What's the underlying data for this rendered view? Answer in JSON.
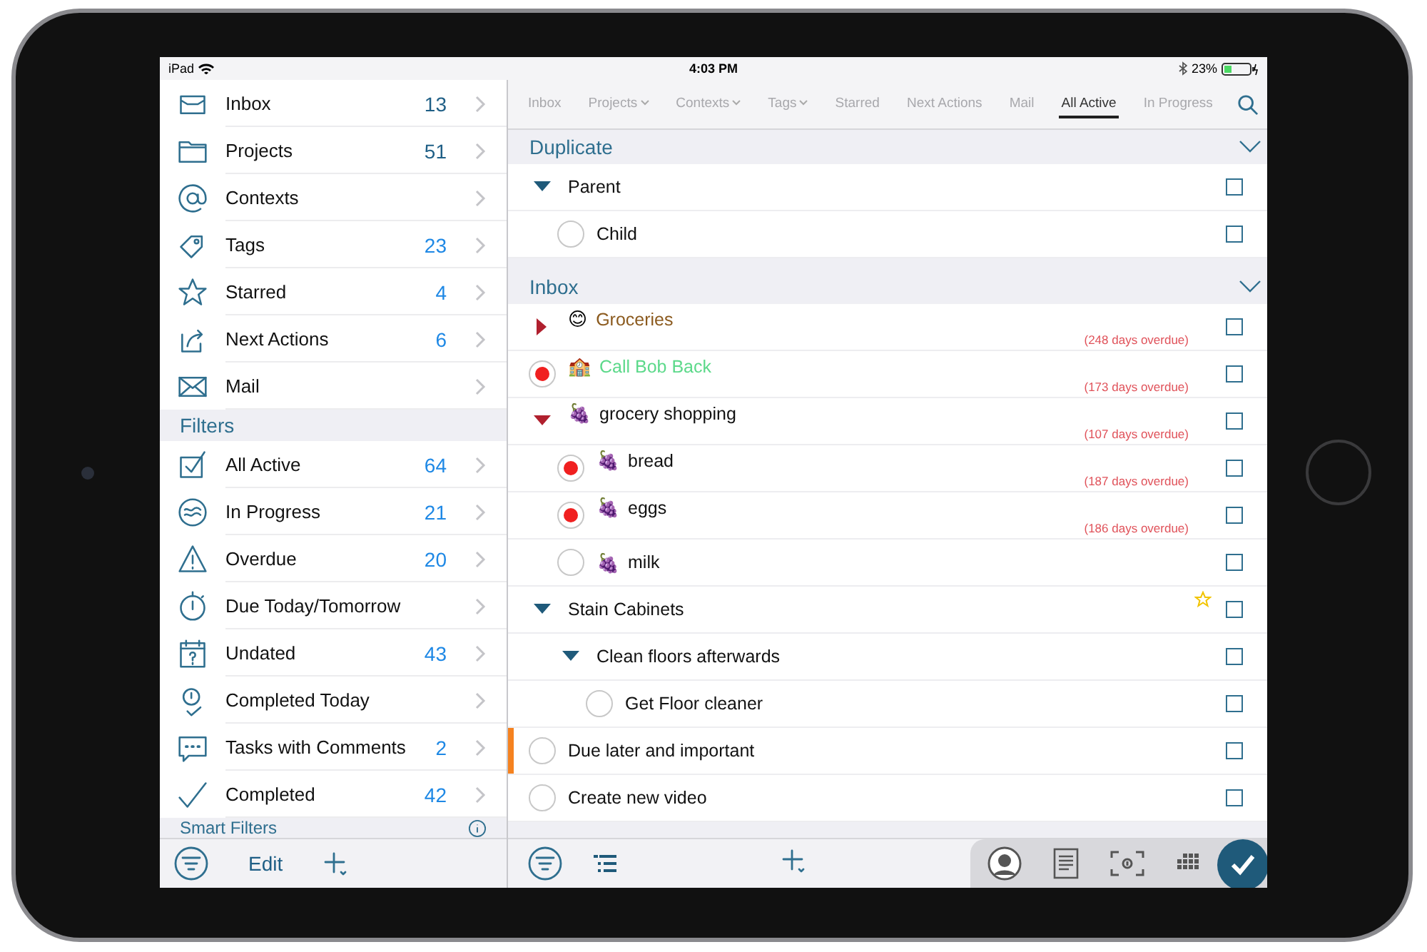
{
  "status_bar": {
    "device": "iPad",
    "time": "4:03 PM",
    "battery": "23%"
  },
  "sidebar": {
    "items": [
      {
        "label": "Inbox",
        "count": "13",
        "color": "#1f5f86"
      },
      {
        "label": "Projects",
        "count": "51",
        "color": "#1f5f86"
      },
      {
        "label": "Contexts"
      },
      {
        "label": "Tags",
        "count": "23",
        "color": "#1e88e5"
      },
      {
        "label": "Starred",
        "count": "4",
        "color": "#1e88e5"
      },
      {
        "label": "Next Actions",
        "count": "6",
        "color": "#1e88e5"
      },
      {
        "label": "Mail"
      }
    ],
    "filters_title": "Filters",
    "filters": [
      {
        "label": "All Active",
        "count": "64",
        "color": "#1e88e5"
      },
      {
        "label": "In Progress",
        "count": "21",
        "color": "#1e88e5"
      },
      {
        "label": "Overdue",
        "count": "20",
        "color": "#1e88e5"
      },
      {
        "label": "Due Today/Tomorrow"
      },
      {
        "label": "Undated",
        "count": "43",
        "color": "#1e88e5"
      },
      {
        "label": "Completed Today"
      },
      {
        "label": "Tasks with Comments",
        "count": "2",
        "color": "#1e88e5"
      },
      {
        "label": "Completed",
        "count": "42",
        "color": "#1e88e5"
      }
    ],
    "smart_filters_title": "Smart Filters",
    "edit": "Edit"
  },
  "tabs": [
    {
      "label": "Inbox",
      "selected": false,
      "has_menu": false
    },
    {
      "label": "Projects",
      "selected": false,
      "has_menu": true
    },
    {
      "label": "Contexts",
      "selected": false,
      "has_menu": true
    },
    {
      "label": "Tags",
      "selected": false,
      "has_menu": true
    },
    {
      "label": "Starred",
      "selected": false,
      "has_menu": false
    },
    {
      "label": "Next Actions",
      "selected": false,
      "has_menu": false
    },
    {
      "label": "Mail",
      "selected": false,
      "has_menu": false
    },
    {
      "label": "All Active",
      "selected": true,
      "has_menu": false
    },
    {
      "label": "In Progress",
      "selected": false,
      "has_menu": false
    }
  ],
  "sections": [
    {
      "title": "Duplicate",
      "expanded": true,
      "tasks": [
        {
          "kind": "project",
          "title": "Parent",
          "expanded": true,
          "starred": false,
          "important": false,
          "checked": false,
          "children": [
            {
              "kind": "task",
              "title": "Child",
              "starred": false,
              "important": false,
              "checked": false
            }
          ]
        }
      ]
    },
    {
      "title": "Inbox",
      "expanded": true,
      "tasks": [
        {
          "kind": "project",
          "title": "Groceries",
          "emoji": "😊",
          "color": "#8b5a1e",
          "overdue": "(248 days overdue)",
          "expanded": false,
          "starred": false,
          "important": false,
          "checked": false
        },
        {
          "kind": "task",
          "title": "Call Bob Back",
          "emoji": "🏫",
          "color": "#5cd98a",
          "overdue": "(173 days overdue)",
          "starred": false,
          "important": false,
          "checked": false
        },
        {
          "kind": "project",
          "title": "grocery shopping",
          "emoji": "🍇",
          "overdue": "(107 days overdue)",
          "expanded": true,
          "starred": false,
          "important": false,
          "checked": false,
          "children": [
            {
              "kind": "task",
              "title": "bread",
              "emoji": "🍇",
              "overdue": "(187 days overdue)",
              "starred": false,
              "important": false,
              "checked": false
            },
            {
              "kind": "task",
              "title": "eggs",
              "emoji": "🍇",
              "overdue": "(186 days overdue)",
              "starred": false,
              "important": false,
              "checked": false
            },
            {
              "kind": "task",
              "title": "milk",
              "emoji": "🍇",
              "starred": false,
              "important": false,
              "checked": false
            }
          ]
        },
        {
          "kind": "project",
          "title": "Stain Cabinets",
          "expanded": true,
          "starred": true,
          "important": false,
          "checked": false,
          "children": [
            {
              "kind": "project",
              "title": "Clean floors afterwards",
              "expanded": true,
              "starred": false,
              "important": false,
              "checked": false,
              "children": [
                {
                  "kind": "task",
                  "title": "Get Floor cleaner",
                  "starred": false,
                  "important": false,
                  "checked": false
                }
              ]
            }
          ]
        },
        {
          "kind": "task",
          "title": "Due later and important",
          "starred": false,
          "important": true,
          "checked": false
        },
        {
          "kind": "task",
          "title": "Create new video",
          "starred": false,
          "important": false,
          "checked": false
        }
      ]
    }
  ]
}
